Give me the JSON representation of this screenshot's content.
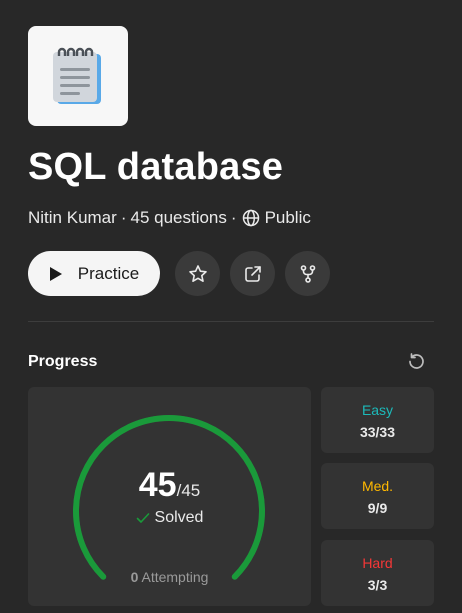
{
  "list": {
    "title": "SQL database",
    "author": "Nitin Kumar",
    "question_count": "45 questions",
    "visibility": "Public",
    "cover_icon": "notepad-icon"
  },
  "actions": {
    "practice_label": "Practice",
    "icons": [
      "star-icon",
      "external-link-icon",
      "fork-icon"
    ]
  },
  "progress": {
    "heading": "Progress",
    "solved": "45",
    "total": "/45",
    "solved_label": "Solved",
    "attempting_count": "0",
    "attempting_label": "Attempting",
    "fraction_complete": 1.0,
    "ring_color": "#1a9a3a"
  },
  "difficulty": [
    {
      "label": "Easy",
      "value": "33/33",
      "color": "#1cbaba"
    },
    {
      "label": "Med.",
      "value": "9/9",
      "color": "#ffb800"
    },
    {
      "label": "Hard",
      "value": "3/3",
      "color": "#f63737"
    }
  ]
}
